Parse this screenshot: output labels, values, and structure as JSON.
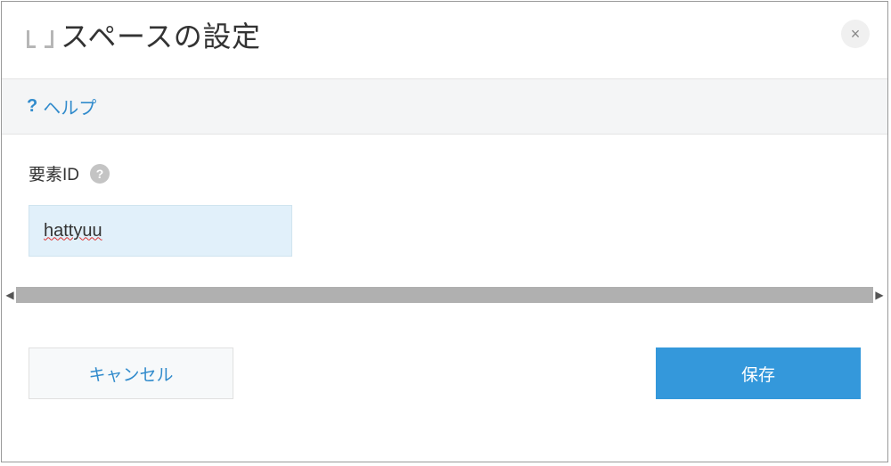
{
  "header": {
    "title": "スペースの設定",
    "close_symbol": "×"
  },
  "helpbar": {
    "icon_symbol": "?",
    "link_label": "ヘルプ"
  },
  "form": {
    "element_id_label": "要素ID",
    "element_id_value": "hattyuu",
    "info_symbol": "?"
  },
  "scrollbar": {
    "left_symbol": "◀",
    "right_symbol": "▶"
  },
  "footer": {
    "cancel_label": "キャンセル",
    "save_label": "保存"
  }
}
